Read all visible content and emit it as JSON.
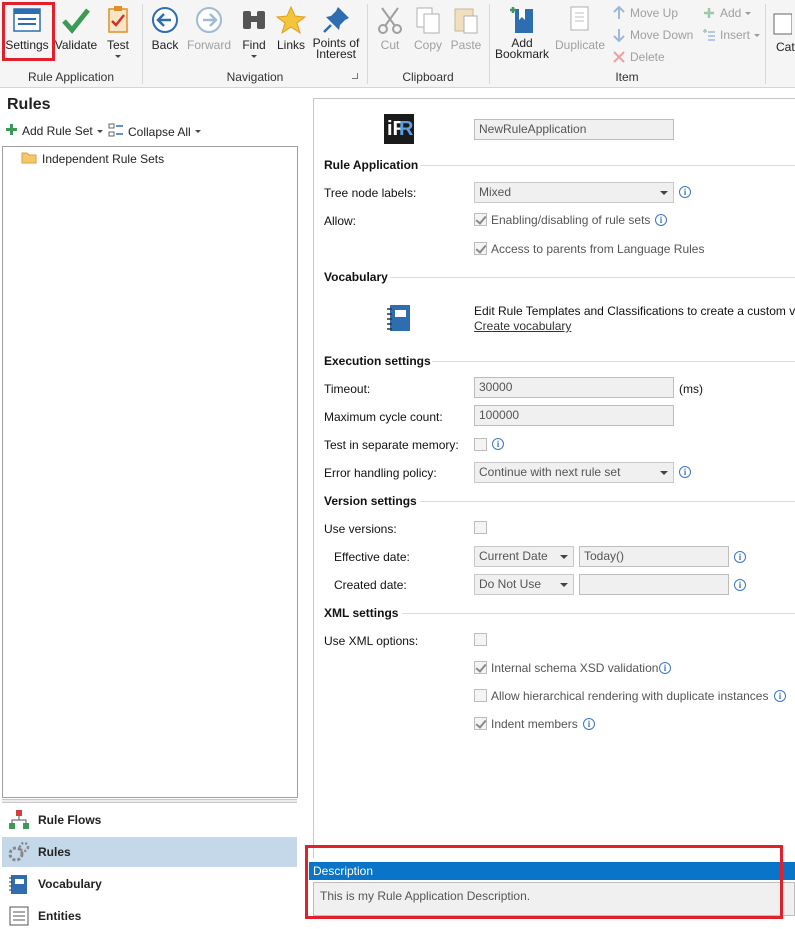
{
  "ribbon": {
    "rule_application": {
      "buttons": [
        {
          "label": "Settings"
        },
        {
          "label": "Validate"
        },
        {
          "label": "Test"
        }
      ],
      "group_label": "Rule Application"
    },
    "navigation": {
      "buttons": [
        {
          "label": "Back"
        },
        {
          "label": "Forward"
        },
        {
          "label": "Find"
        },
        {
          "label": "Links"
        },
        {
          "label": "Points of Interest"
        }
      ],
      "group_label": "Navigation"
    },
    "clipboard": {
      "buttons": [
        {
          "label": "Cut"
        },
        {
          "label": "Copy"
        },
        {
          "label": "Paste"
        }
      ],
      "group_label": "Clipboard"
    },
    "item": {
      "buttons": [
        {
          "label": "Add Bookmark"
        },
        {
          "label": "Duplicate"
        }
      ],
      "small_buttons": [
        {
          "label": "Move Up"
        },
        {
          "label": "Move Down"
        },
        {
          "label": "Delete"
        },
        {
          "label": "Add"
        },
        {
          "label": "Insert"
        }
      ],
      "group_label": "Item"
    },
    "overflow_label": "Cat"
  },
  "left_panel": {
    "title": "Rules",
    "add_rule_set": "Add Rule Set",
    "collapse_all": "Collapse All",
    "tree": [
      {
        "label": "Independent Rule Sets"
      }
    ],
    "nav": [
      {
        "label": "Rule Flows"
      },
      {
        "label": "Rules"
      },
      {
        "label": "Vocabulary"
      },
      {
        "label": "Entities"
      }
    ]
  },
  "main": {
    "logo_text": "iR",
    "app_name": "NewRuleApplication",
    "rule_application": {
      "title": "Rule Application",
      "tree_node_labels_label": "Tree node labels:",
      "tree_node_labels_value": "Mixed",
      "allow_label": "Allow:",
      "allow_enabling": "Enabling/disabling of rule sets",
      "allow_parents": "Access to parents from Language Rules"
    },
    "vocabulary": {
      "title": "Vocabulary",
      "text": "Edit Rule Templates and Classifications to create a custom vo",
      "link": "Create vocabulary"
    },
    "execution": {
      "title": "Execution settings",
      "timeout_label": "Timeout:",
      "timeout_value": "30000",
      "timeout_unit": "(ms)",
      "max_cycle_label": "Maximum cycle count:",
      "max_cycle_value": "100000",
      "separate_memory_label": "Test in separate memory:",
      "error_policy_label": "Error handling policy:",
      "error_policy_value": "Continue with next rule set"
    },
    "version": {
      "title": "Version settings",
      "use_versions_label": "Use versions:",
      "effective_label": "Effective date:",
      "effective_mode": "Current Date",
      "effective_value": "Today()",
      "created_label": "Created date:",
      "created_mode": "Do Not Use",
      "created_value": ""
    },
    "xml": {
      "title": "XML settings",
      "use_xml_label": "Use XML options:",
      "schema_validation": "Internal schema XSD validation",
      "hierarchical": "Allow hierarchical rendering with duplicate instances",
      "indent": "Indent members"
    },
    "description": {
      "header": "Description",
      "text": "This is my Rule Application Description."
    }
  },
  "info_symbol": "i",
  "colors": {
    "accent": "#0a74c9",
    "highlight": "#e0202a",
    "selected_nav": "#c5d8ea"
  }
}
